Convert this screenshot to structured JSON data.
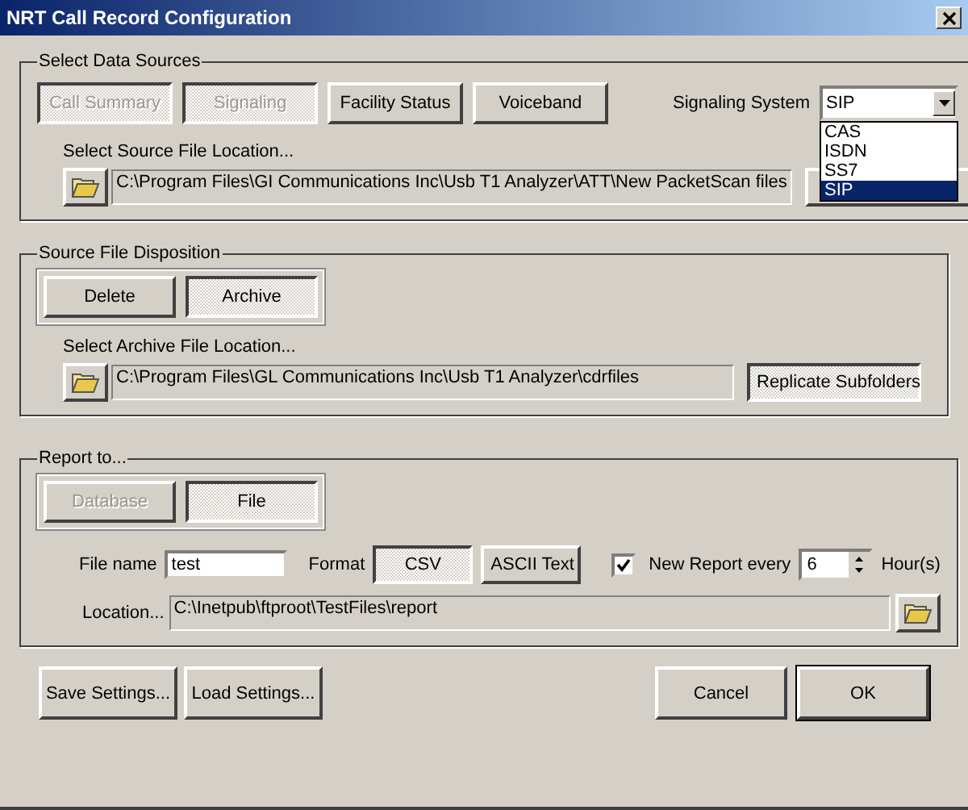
{
  "window": {
    "title": "NRT Call Record Configuration"
  },
  "data_sources": {
    "title": "Select Data Sources",
    "toggles": [
      {
        "label": "Call Summary",
        "selected": true,
        "disabled": true
      },
      {
        "label": "Signaling",
        "selected": true,
        "disabled": true
      },
      {
        "label": "Facility Status",
        "selected": false,
        "disabled": false
      },
      {
        "label": "Voiceband",
        "selected": false,
        "disabled": false
      }
    ],
    "signaling_label": "Signaling System",
    "signaling_value": "SIP",
    "options": [
      {
        "label": "CAS",
        "selected": false
      },
      {
        "label": "ISDN",
        "selected": false
      },
      {
        "label": "SS7",
        "selected": false
      },
      {
        "label": "SIP",
        "selected": true
      }
    ],
    "location_label": "Select Source File Location...",
    "path": "C:\\Program Files\\GI Communications Inc\\Usb T1 Analyzer\\ATT\\New PacketScan files"
  },
  "disposition": {
    "title": "Source File Disposition",
    "toggles": [
      {
        "label": "Delete",
        "selected": false,
        "disabled": false
      },
      {
        "label": "Archive",
        "selected": true,
        "disabled": false
      }
    ],
    "location_label": "Select Archive File Location...",
    "path": "C:\\Program Files\\GL Communications Inc\\Usb T1 Analyzer\\cdrfiles",
    "replicate": {
      "label": "Replicate Subfolders",
      "selected": true
    }
  },
  "report": {
    "title": "Report to...",
    "toggles": [
      {
        "label": "Database",
        "selected": false,
        "disabled": true
      },
      {
        "label": "File",
        "selected": true,
        "disabled": false
      }
    ],
    "file_name_label": "File name",
    "file_name": "test",
    "format_label": "Format",
    "formats": [
      {
        "label": "CSV",
        "selected": true
      },
      {
        "label": "ASCII Text",
        "selected": false
      }
    ],
    "new_report": {
      "label": "New Report every",
      "checked": true,
      "value": "6",
      "unit": "Hour(s)"
    },
    "location_label": "Location...",
    "path": "C:\\Inetpub\\ftproot\\TestFiles\\report"
  },
  "buttons": {
    "left": [
      "Save Settings...",
      "Load Settings..."
    ],
    "cancel": "Cancel",
    "ok": "OK"
  }
}
